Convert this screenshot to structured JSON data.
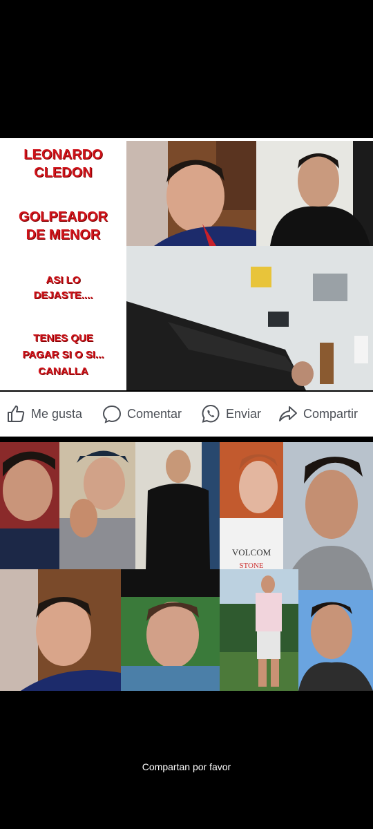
{
  "post": {
    "lines": [
      "LEONARDO",
      "CLEDON",
      "GOLPEADOR",
      "DE MENOR",
      "ASI LO",
      "DEJASTE....",
      "TENES QUE",
      "PAGAR SI O SI...",
      "CANALLA"
    ],
    "text_color": "#d0141b"
  },
  "actions": {
    "like": "Me gusta",
    "comment": "Comentar",
    "send": "Enviar",
    "share": "Compartir"
  },
  "collage_shirt_text": [
    "VOLCOM",
    "STONE"
  ],
  "footer": {
    "caption": "Compartan por favor"
  }
}
